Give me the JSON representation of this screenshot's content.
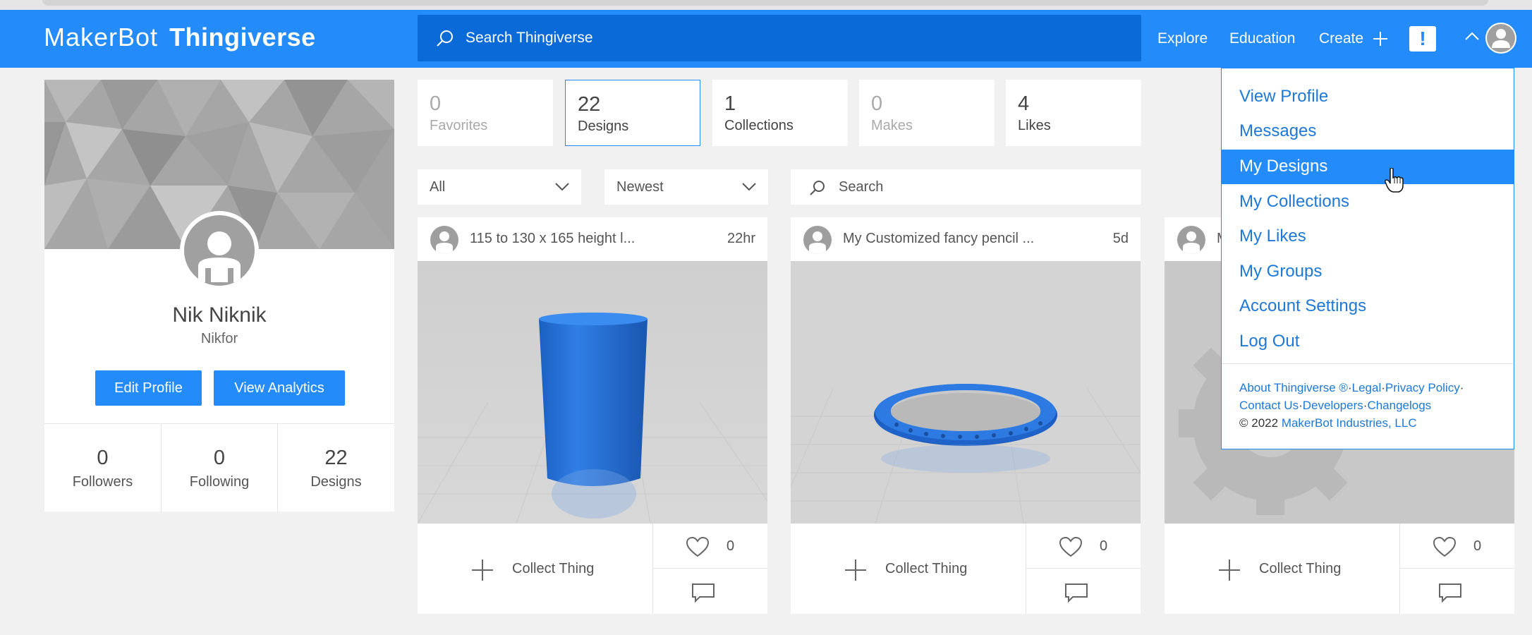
{
  "header": {
    "brand_prefix": "MakerBot",
    "brand_name": "Thingiverse",
    "search_placeholder": "Search Thingiverse",
    "nav": {
      "explore": "Explore",
      "education": "Education",
      "create": "Create",
      "create_icon": "+",
      "alert_icon": "!"
    }
  },
  "profile": {
    "name": "Nik Niknik",
    "username": "Nikfor",
    "edit_label": "Edit Profile",
    "analytics_label": "View Analytics",
    "stats": [
      {
        "count": "0",
        "label": "Followers"
      },
      {
        "count": "0",
        "label": "Following"
      },
      {
        "count": "22",
        "label": "Designs"
      }
    ]
  },
  "tabs": [
    {
      "count": "0",
      "label": "Favorites"
    },
    {
      "count": "22",
      "label": "Designs"
    },
    {
      "count": "1",
      "label": "Collections"
    },
    {
      "count": "0",
      "label": "Makes"
    },
    {
      "count": "4",
      "label": "Likes"
    }
  ],
  "filters": {
    "type": "All",
    "sort": "Newest",
    "search_placeholder": "Search"
  },
  "cards": [
    {
      "title": "115 to 130 x 165 height l...",
      "age": "22hr",
      "collect_label": "Collect Thing",
      "likes": "0"
    },
    {
      "title": "My Customized fancy pencil ...",
      "age": "5d",
      "collect_label": "Collect Thing",
      "likes": "0"
    },
    {
      "title": "M",
      "age": "",
      "collect_label": "Collect Thing",
      "likes": "0"
    }
  ],
  "dropdown": {
    "items": [
      "View Profile",
      "Messages",
      "My Designs",
      "My Collections",
      "My Likes",
      "My Groups",
      "Account Settings",
      "Log Out"
    ],
    "highlighted": "My Designs",
    "footer": {
      "about": "About Thingiverse ®",
      "legal": "Legal",
      "privacy": "Privacy Policy",
      "contact": "Contact Us",
      "developers": "Developers",
      "changelogs": "Changelogs",
      "copyright": "©  2022",
      "company": "MakerBot Industries, LLC",
      "sep": "·"
    }
  },
  "colors": {
    "primary": "#248bfb",
    "search_bg": "#0a6ad8",
    "link": "#1e78d6"
  }
}
